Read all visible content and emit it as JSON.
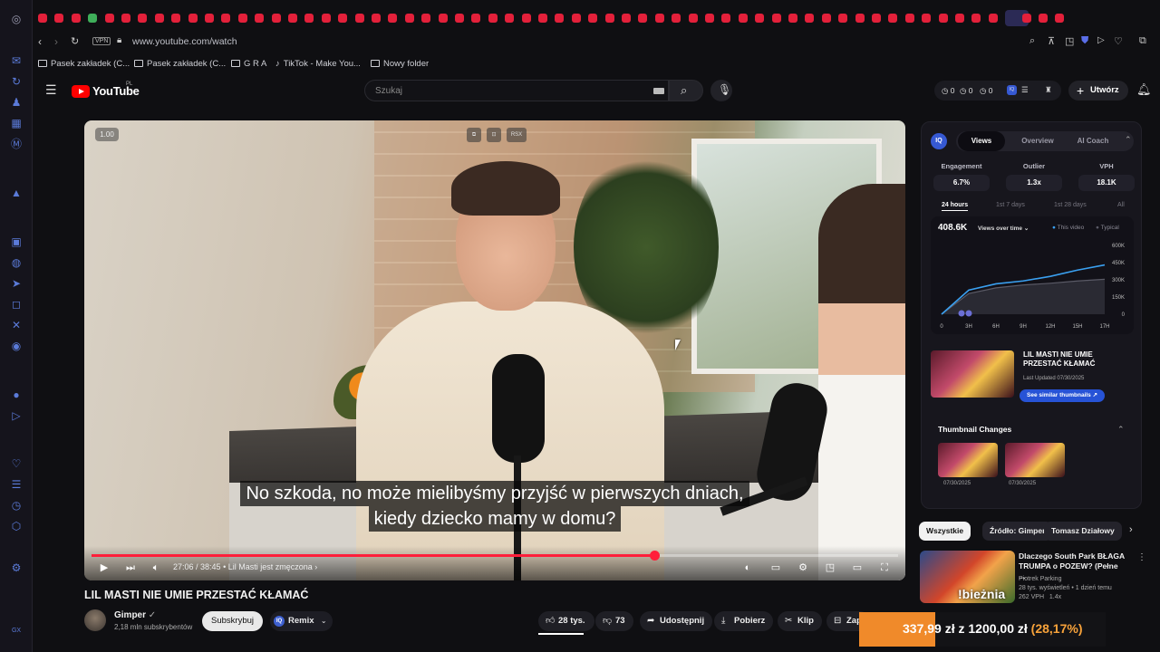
{
  "browser": {
    "url": "www.youtube.com/watch",
    "vpn_label": "VPN",
    "bookmarks": [
      "Pasek zakładek (C...",
      "Pasek zakładek (C...",
      "G R A",
      "TikTok - Make You...",
      "Nowy folder"
    ]
  },
  "header": {
    "logo_text": "YouTube",
    "logo_region": "PL",
    "search_placeholder": "Szukaj",
    "create_label": "Utwórz",
    "counters": [
      "0",
      "0",
      "0"
    ]
  },
  "player": {
    "speed_badge": "1.00",
    "top_icon_label": "RSX",
    "subtitle_line1": "No szkoda, no może mielibyśmy przyjść w pierwszych dniach,",
    "subtitle_line2": "kiedy dziecko mamy w domu?",
    "time_text": "27:06 / 38:45",
    "chapter": "• Lil Masti jest zmęczona",
    "progress": 0.698
  },
  "video": {
    "title": "LIL MASTI NIE UMIE PRZESTAĆ KŁAMAĆ",
    "channel": "Gimper",
    "subscribers": "2,18 mln subskrybentów",
    "subscribe_label": "Subskrybuj",
    "remix_label": "Remix",
    "remix_badge": "IQ",
    "likes": "28 tys.",
    "dislikes": "73",
    "share_label": "Udostępnij",
    "download_label": "Pobierz",
    "clip_label": "Klip",
    "save_label": "Zap"
  },
  "panel": {
    "badge": "IQ",
    "tabs": [
      "Views",
      "Overview",
      "AI Coach"
    ],
    "active_tab": 0,
    "metrics": [
      {
        "label": "Engagement",
        "value": "6.7%"
      },
      {
        "label": "Outlier",
        "value": "1.3x"
      },
      {
        "label": "VPH",
        "value": "18.1K"
      }
    ],
    "periods": [
      "24 hours",
      "1st 7 days",
      "1st 28 days",
      "All"
    ],
    "views_total": "408.6K",
    "views_selector": "Views over time",
    "legend": [
      "This video",
      "Typical"
    ],
    "thumb_title": "LIL MASTI NIE UMIE PRZESTAĆ KŁAMAĆ",
    "last_updated": "Last Updated 07/30/2025",
    "see_similar": "See similar thumbnails",
    "thumb_changes_title": "Thumbnail Changes",
    "thumb_change_dates": [
      "07/30/2025",
      "07/30/2025"
    ]
  },
  "chart_data": {
    "type": "line",
    "x": [
      "0",
      "3H",
      "6H",
      "9H",
      "12H",
      "15H",
      "17H"
    ],
    "y_ticks": [
      "600K",
      "450K",
      "300K",
      "150K",
      "0"
    ],
    "ylim": [
      0,
      600000
    ],
    "series": [
      {
        "name": "This video",
        "values": [
          0,
          210000,
          265000,
          290000,
          330000,
          385000,
          430000
        ]
      },
      {
        "name": "Typical",
        "values": [
          0,
          180000,
          230000,
          255000,
          270000,
          290000,
          305000
        ]
      }
    ]
  },
  "chips": [
    "Wszystkie",
    "Źródło: Gimper",
    "Tomasz Działowy"
  ],
  "recommendation": {
    "title": "Dlaczego South Park BŁAGA TRUMPA o POZEW? (Pełne ...",
    "channel": "Piotrek Parking",
    "meta": "28 tys. wyświetleń • 1 dzień temu",
    "badge1": "262 VPH",
    "badge2": "1.4x",
    "thumb_text": "!bieżnia"
  },
  "overlay": {
    "amount": "337,99 zł",
    "of": "z",
    "goal": "1200,00 zł",
    "percent": "(28,17%)"
  },
  "colors": {
    "accent_red": "#ff0000",
    "progress": "#ff1e3a",
    "panel_blue": "#3659d3",
    "this_video_line": "#3aa0f0",
    "typical_line": "#5a5a66"
  }
}
